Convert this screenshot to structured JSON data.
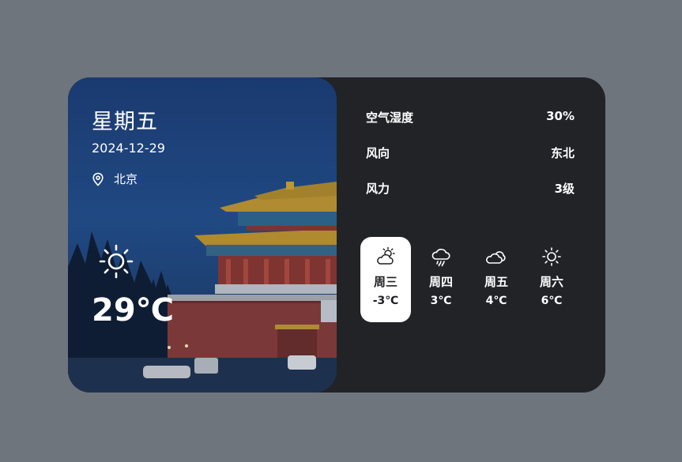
{
  "weather": {
    "weekday": "星期五",
    "date": "2024-12-29",
    "location": "北京",
    "current_icon": "sun-icon",
    "temperature": "29℃"
  },
  "stats": [
    {
      "label": "空气湿度",
      "value": "30%"
    },
    {
      "label": "风向",
      "value": "东北"
    },
    {
      "label": "风力",
      "value": "3级"
    }
  ],
  "forecast": [
    {
      "day": "周三",
      "temp": "-3℃",
      "icon": "partly-cloudy-sun-icon",
      "selected": true
    },
    {
      "day": "周四",
      "temp": "3℃",
      "icon": "cloud-rain-icon",
      "selected": false
    },
    {
      "day": "周五",
      "temp": "4℃",
      "icon": "cloudy-icon",
      "selected": false
    },
    {
      "day": "周六",
      "temp": "6℃",
      "icon": "sun-icon",
      "selected": false
    }
  ]
}
